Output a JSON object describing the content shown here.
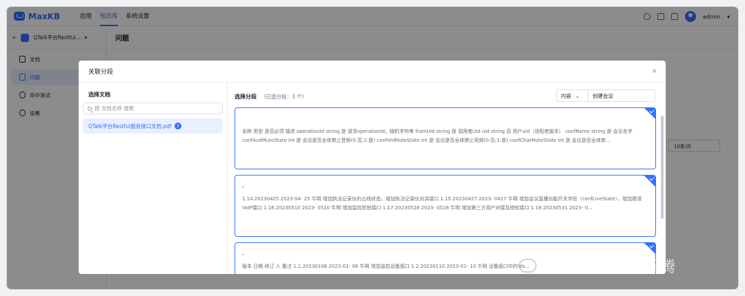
{
  "app": {
    "logo": "MaxKB"
  },
  "nav": [
    "应用",
    "知识库",
    "系统设置"
  ],
  "user": {
    "name": "admin"
  },
  "sidebar": {
    "kb_name": "QTalk平台Restful...",
    "items": [
      {
        "label": "文档",
        "icon": "document-icon"
      },
      {
        "label": "问题",
        "icon": "question-icon"
      },
      {
        "label": "命中测试",
        "icon": "target-icon"
      },
      {
        "label": "设置",
        "icon": "gear-icon"
      }
    ]
  },
  "main": {
    "title": "问题",
    "pager": "10条/页"
  },
  "modal": {
    "title": "关联分段",
    "left": {
      "title": "选择文档",
      "search_placeholder": "按 文档名称 搜索",
      "doc_name": "QTalk平台Restful服务接口文档.pdf",
      "doc_count": "3"
    },
    "right": {
      "title": "选择分段",
      "selected": "（已选分段：3 个）",
      "filter_type": "内容",
      "filter_value": "创建会议",
      "cards": [
        {
          "title": "",
          "text": "名称 类型 是否必须 描述 operationId string 是 请求operationId，随机字符串 fromUId string 是 调用者UId uid string 否 用户uid（适配老版本） confName string 是 会议名字 confAudMuteState int 是 会议是否全体禁止音频(0:否;1:是) confVidMuteState int 是 会议是否全体禁止视频(0:否;1:是) confChatMuteState int 是 会议是否全体禁..."
        },
        {
          "title": "-",
          "text": "1.14.20230425 2023-04- 25 牛明 增加执法记录仪的占线状态，增加执法记录仪对讲接口 1.15.20230427 2023- 0427 牛明 增加会议直播功能开关字段（confLiveState），增加邀请VoIP接口 1.16.20230510 2023- 0510 牛明 增加监控抓拍接口 1.17.20230528 2023- 0528 牛明 增加第三方用户对接及授权接口 1.18.20230531 2023- 0..."
        },
        {
          "title": "-",
          "text": "版本 日期 修订 人 备注 1.1.20230108 2023-01- 08 牛明 增加监控设备接口 1.2.20230110 2023-01- 10 牛明 设备接口中的Ws..."
        }
      ]
    }
  },
  "watermark": "公众号 · 各种折腾"
}
